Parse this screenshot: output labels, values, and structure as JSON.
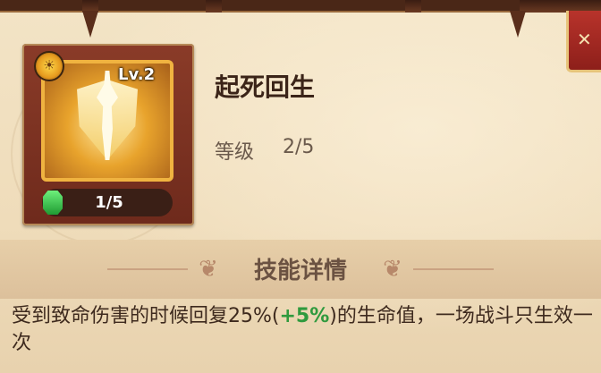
{
  "skill": {
    "name": "起死回生",
    "level_badge": "Lv.2",
    "level_label": "等级",
    "level_value": "2/5",
    "progress_text": "1/5",
    "progress_fraction": 0.2
  },
  "details": {
    "section_title": "技能详情",
    "desc_part1": "受到致命伤害的时候回复25%(",
    "desc_bonus": "+5%",
    "desc_part2": ")的生命值，一场战斗只生效一次"
  },
  "colors": {
    "title": "#3b2418",
    "bonus_green": "#2f9a3e",
    "icon_border": "#f0b340",
    "frame": "#8a3b28"
  },
  "icons": {
    "emblem": "sun-icon",
    "skill_art": "shield-figure-icon",
    "progress": "green-gem-icon",
    "close": "close-icon",
    "ornament": "swirl-ornament-icon"
  }
}
